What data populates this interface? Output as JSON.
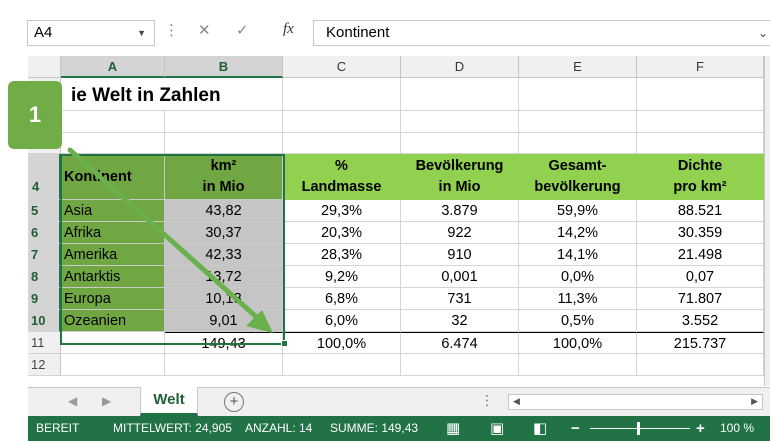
{
  "formula_bar": {
    "name_box": "A4",
    "fx_label": "fx",
    "formula_value": "Kontinent"
  },
  "columns": [
    "A",
    "B",
    "C",
    "D",
    "E",
    "F"
  ],
  "rows": [
    "4",
    "5",
    "6",
    "7",
    "8",
    "9",
    "10",
    "11",
    "12"
  ],
  "title": "ie Welt in Zahlen",
  "headers": {
    "a": "Kontinent",
    "b": [
      "km²",
      "in Mio"
    ],
    "c": [
      "%",
      "Landmasse"
    ],
    "d": [
      "Bevölkerung",
      "in Mio"
    ],
    "e": [
      "Gesamt-",
      "bevölkerung"
    ],
    "f": [
      "Dichte",
      "pro km²"
    ]
  },
  "table_rows": [
    {
      "a": "Asia",
      "b": "43,82",
      "c": "29,3%",
      "d": "3.879",
      "e": "59,9%",
      "f": "88.521"
    },
    {
      "a": "Afrika",
      "b": "30,37",
      "c": "20,3%",
      "d": "922",
      "e": "14,2%",
      "f": "30.359"
    },
    {
      "a": "Amerika",
      "b": "42,33",
      "c": "28,3%",
      "d": "910",
      "e": "14,1%",
      "f": "21.498"
    },
    {
      "a": "Antarktis",
      "b": "13,72",
      "c": "9,2%",
      "d": "0,001",
      "e": "0,0%",
      "f": "0,07"
    },
    {
      "a": "Europa",
      "b": "10,18",
      "c": "6,8%",
      "d": "731",
      "e": "11,3%",
      "f": "71.807"
    },
    {
      "a": "Ozeanien",
      "b": "9,01",
      "c": "6,0%",
      "d": "32",
      "e": "0,5%",
      "f": "3.552"
    }
  ],
  "totals": {
    "b": "149,43",
    "c": "100,0%",
    "d": "6.474",
    "e": "100,0%",
    "f": "215.737"
  },
  "sheet_tab": "Welt",
  "status_bar": {
    "mode": "BEREIT",
    "average": "MITTELWERT: 24,905",
    "count": "ANZAHL: 14",
    "sum": "SUMME: 149,43",
    "zoom": "100 %"
  },
  "annotation": {
    "badge": "1"
  },
  "colors": {
    "header_green": "#92d050",
    "column_a_green": "#70a742",
    "selection_gray": "#c5c5c5",
    "excel_green": "#217346"
  }
}
